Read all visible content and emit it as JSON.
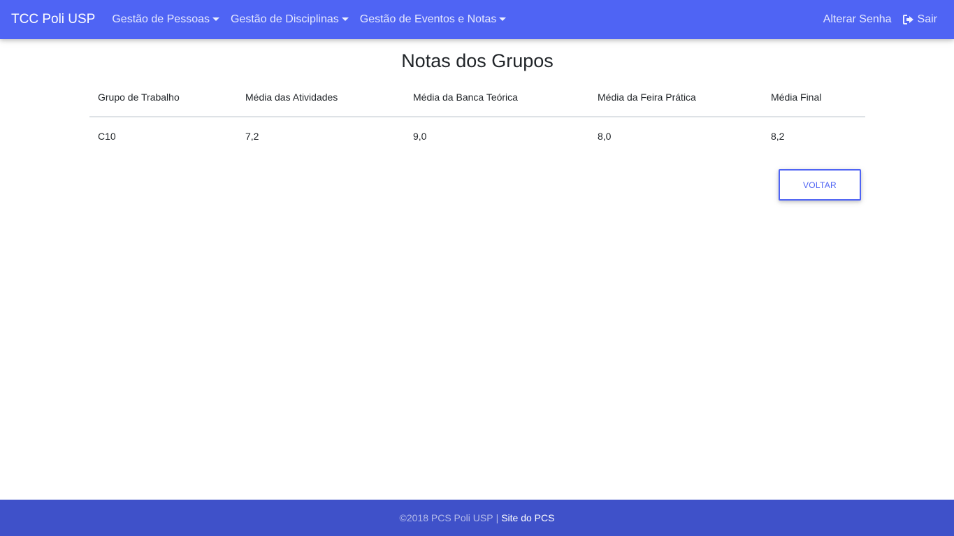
{
  "navbar": {
    "brand": "TCC Poli USP",
    "menus": [
      {
        "label": "Gestão de Pessoas"
      },
      {
        "label": "Gestão de Disciplinas"
      },
      {
        "label": "Gestão de Eventos e Notas"
      }
    ],
    "change_password": "Alterar Senha",
    "logout": "Sair",
    "logout_icon": "sign-out-icon",
    "background_color": "#4f64f4"
  },
  "page": {
    "title": "Notas dos Grupos"
  },
  "table": {
    "headers": [
      "Grupo de Trabalho",
      "Média das Atividades",
      "Média da Banca Teórica",
      "Média da Feira Prática",
      "Média Final"
    ],
    "rows": [
      [
        "C10",
        "7,2",
        "9,0",
        "8,0",
        "8,2"
      ]
    ]
  },
  "actions": {
    "back_label": "VOLTAR",
    "accent_color": "#4f64f4"
  },
  "footer": {
    "copyright": "©2018 PCS Poli USP",
    "separator": "|",
    "link": "Site do PCS",
    "background_color": "#3f51c9"
  }
}
